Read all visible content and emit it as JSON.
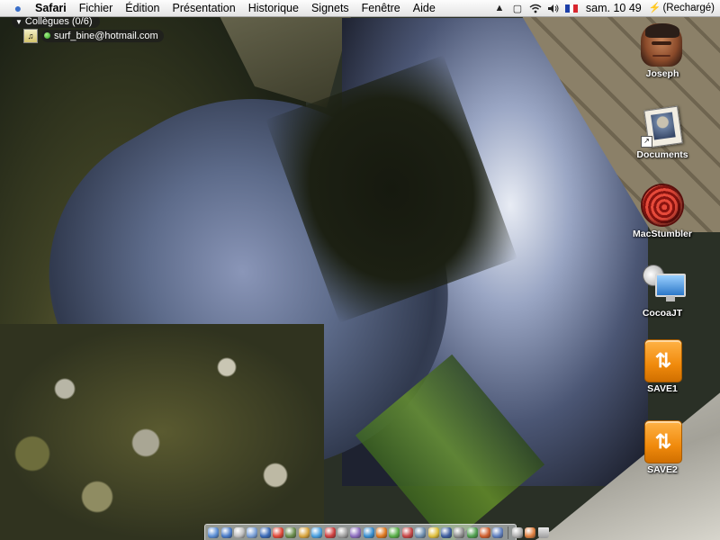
{
  "menubar": {
    "apple_icon": "apple-icon",
    "app_name": "Safari",
    "menus": [
      "Fichier",
      "Édition",
      "Présentation",
      "Historique",
      "Signets",
      "Fenêtre",
      "Aide"
    ],
    "status_icons": [
      "spy-icon",
      "display-icon",
      "wifi-icon",
      "volume-icon",
      "french-flag-icon"
    ],
    "clock": "sam. 10 49",
    "battery_status": "(Rechargé)"
  },
  "buddy_list": {
    "group_label": "Collègues (0/6)",
    "buddy_name": "surf_bine@hotmail.com",
    "status_color": "#27a01b"
  },
  "desktop_icons": [
    {
      "label": "Joseph",
      "icon": "person-portrait-icon"
    },
    {
      "label": "Documents",
      "icon": "documents-alias-icon"
    },
    {
      "label": "MacStumbler",
      "icon": "macstumbler-icon"
    },
    {
      "label": "CocoaJT",
      "icon": "cocoajt-icon"
    },
    {
      "label": "SAVE1",
      "icon": "usb-drive-icon"
    },
    {
      "label": "SAVE2",
      "icon": "usb-drive-icon"
    }
  ],
  "dock": {
    "item_colors": [
      "#5b8fd6",
      "#4a7cc9",
      "#c0c0c0",
      "#7aa0d8",
      "#3b6bb8",
      "#e04a3a",
      "#6b8e4e",
      "#d9a640",
      "#4aa0e0",
      "#d04040",
      "#a0a0a0",
      "#8e6fc0",
      "#3a8fd0",
      "#e07a20",
      "#5ab04a",
      "#c84848",
      "#7090b0",
      "#e0c040",
      "#4060a0",
      "#909090",
      "#50a050",
      "#d06030",
      "#6080c0",
      "#b0b0b0",
      "#e08040"
    ],
    "separator_after": 22,
    "trash_icon": "trash-icon"
  },
  "colors": {
    "menubar_bg": "#eeeeee",
    "icon_label": "#ffffff"
  }
}
